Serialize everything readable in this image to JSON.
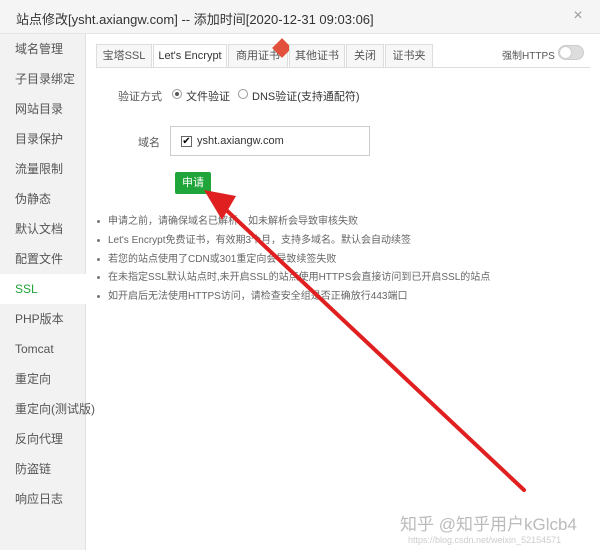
{
  "window": {
    "title": "站点修改[ysht.axiangw.com] -- 添加时间[2020-12-31 09:03:06]",
    "close_glyph": "×"
  },
  "sidebar": {
    "items": [
      {
        "label": "域名管理"
      },
      {
        "label": "子目录绑定"
      },
      {
        "label": "网站目录"
      },
      {
        "label": "目录保护"
      },
      {
        "label": "流量限制"
      },
      {
        "label": "伪静态"
      },
      {
        "label": "默认文档"
      },
      {
        "label": "配置文件"
      },
      {
        "label": "SSL"
      },
      {
        "label": "PHP版本"
      },
      {
        "label": "Tomcat"
      },
      {
        "label": "重定向"
      },
      {
        "label": "重定向(测试版)"
      },
      {
        "label": "反向代理"
      },
      {
        "label": "防盗链"
      },
      {
        "label": "响应日志"
      }
    ],
    "active_index": 8
  },
  "tabs": [
    {
      "label": "宝塔SSL"
    },
    {
      "label": "Let's Encrypt"
    },
    {
      "label": "商用证书"
    },
    {
      "label": "其他证书"
    },
    {
      "label": "关闭"
    },
    {
      "label": "证书夹"
    }
  ],
  "force_https": {
    "label": "强制HTTPS",
    "enabled": false
  },
  "verify": {
    "label": "验证方式",
    "options": [
      {
        "label": "文件验证",
        "checked": true
      },
      {
        "label": "DNS验证(支持通配符)",
        "checked": false
      }
    ]
  },
  "domain": {
    "label": "域名",
    "value": "ysht.axiangw.com",
    "checked": true,
    "check_glyph": "✔"
  },
  "apply_button": {
    "label": "申请"
  },
  "tips": [
    "申请之前，请确保域名已解析，如未解析会导致审核失败",
    "Let's Encrypt免费证书，有效期3个月，支持多域名。默认会自动续签",
    "若您的站点使用了CDN或301重定向会导致续签失败",
    "在未指定SSL默认站点时,未开启SSL的站点使用HTTPS会直接访问到已开启SSL的站点",
    "如开启后无法使用HTTPS访问，请检查安全组是否正确放行443端口"
  ],
  "annotation_arrow": {
    "color": "#e02020"
  },
  "watermark": {
    "text": "知乎 @知乎用户kGlcb4",
    "url": "https://blog.csdn.net/weixin_52154571"
  },
  "colors": {
    "accent": "#20a53a",
    "ribbon": "#e24f3d"
  }
}
